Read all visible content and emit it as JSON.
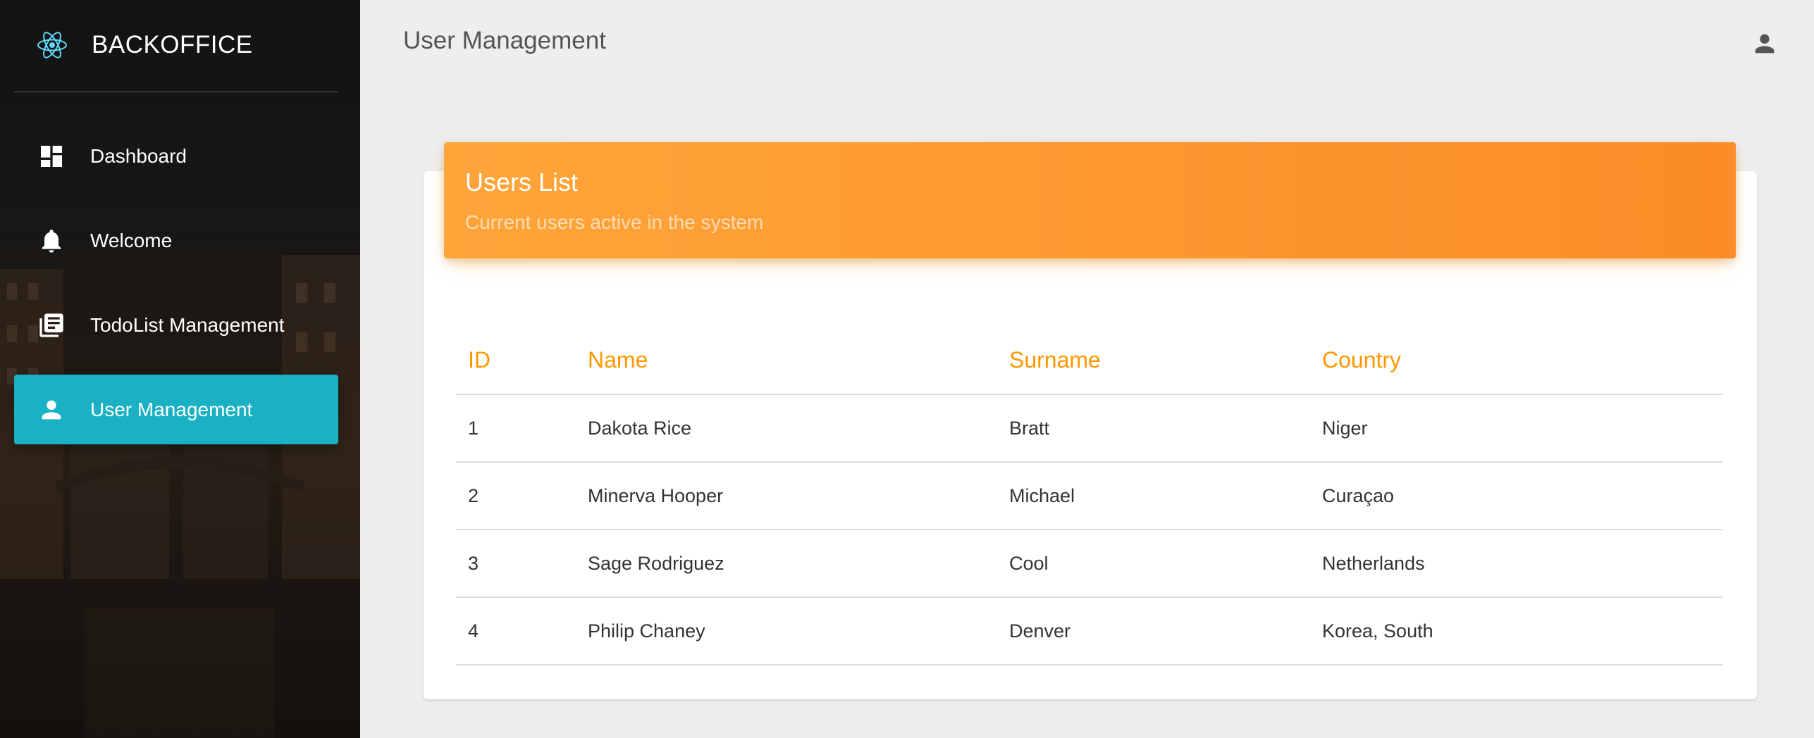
{
  "app": {
    "brand": "BACKOFFICE",
    "page_title": "User Management"
  },
  "sidebar": {
    "items": [
      {
        "label": "Dashboard",
        "icon": "dashboard-icon",
        "active": false
      },
      {
        "label": "Welcome",
        "icon": "bell-icon",
        "active": false
      },
      {
        "label": "TodoList Management",
        "icon": "library-books-icon",
        "active": false
      },
      {
        "label": "User Management",
        "icon": "person-icon",
        "active": true
      }
    ]
  },
  "card": {
    "title": "Users List",
    "subtitle": "Current users active in the system"
  },
  "table": {
    "headers": [
      "ID",
      "Name",
      "Surname",
      "Country"
    ],
    "rows": [
      [
        "1",
        "Dakota Rice",
        "Bratt",
        "Niger"
      ],
      [
        "2",
        "Minerva Hooper",
        "Michael",
        "Curaçao"
      ],
      [
        "3",
        "Sage Rodriguez",
        "Cool",
        "Netherlands"
      ],
      [
        "4",
        "Philip Chaney",
        "Denver",
        "Korea, South"
      ]
    ]
  },
  "colors": {
    "accent": "#ff9800",
    "active_nav": "#1ab1c4",
    "header_gradient_start": "#ffa53a",
    "header_gradient_end": "#fb8c28"
  }
}
